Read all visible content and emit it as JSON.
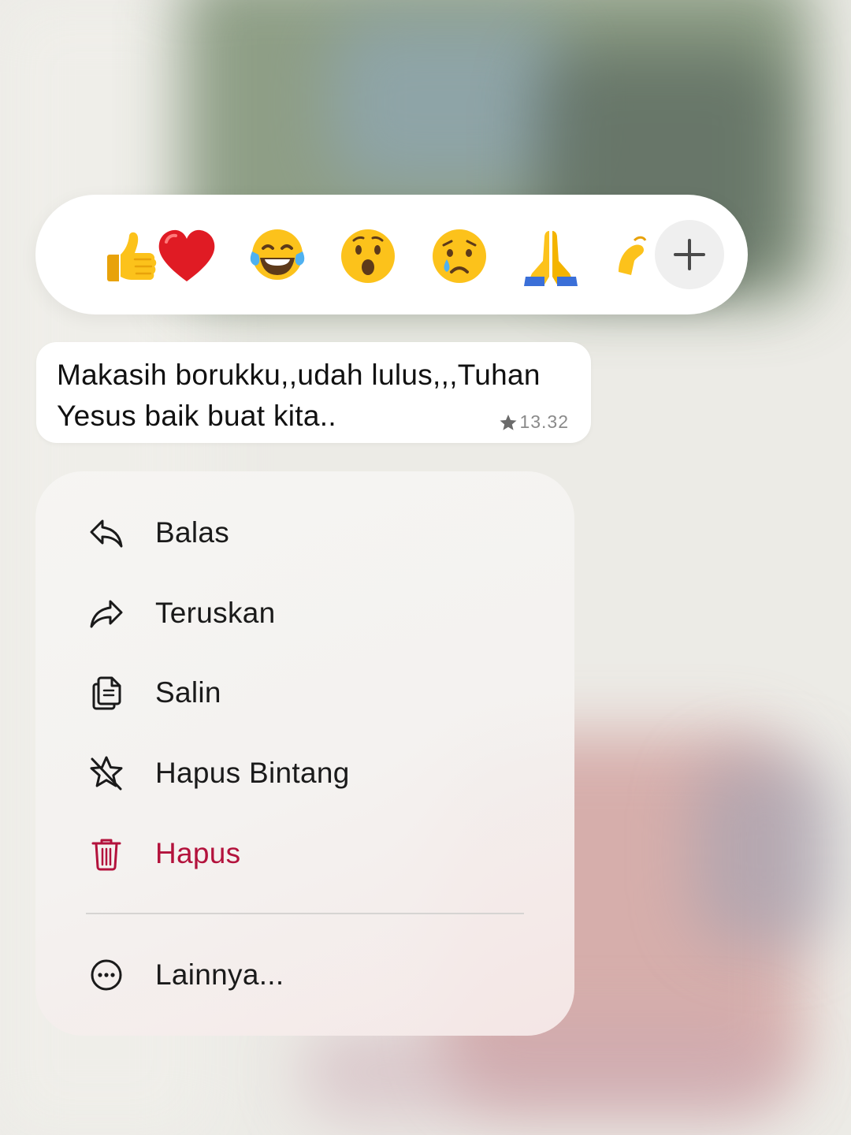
{
  "reaction_bar": {
    "emojis": [
      "thumbs-up",
      "red-heart",
      "tears-of-joy",
      "surprised-face",
      "crying-face",
      "folded-hands",
      "heart-hands"
    ],
    "more_icon": "plus-icon"
  },
  "message": {
    "text": "Makasih borukku,,udah lulus,,,Tuhan Yesus baik buat kita..",
    "starred_icon": "star-icon",
    "time": "13.32"
  },
  "menu": {
    "reply": {
      "label": "Balas",
      "icon": "reply-icon"
    },
    "forward": {
      "label": "Teruskan",
      "icon": "forward-icon"
    },
    "copy": {
      "label": "Salin",
      "icon": "copy-icon"
    },
    "unstar": {
      "label": "Hapus Bintang",
      "icon": "unstar-icon"
    },
    "delete": {
      "label": "Hapus",
      "icon": "trash-icon",
      "color": "#b3123c"
    },
    "more": {
      "label": "Lainnya...",
      "icon": "more-icon"
    }
  }
}
